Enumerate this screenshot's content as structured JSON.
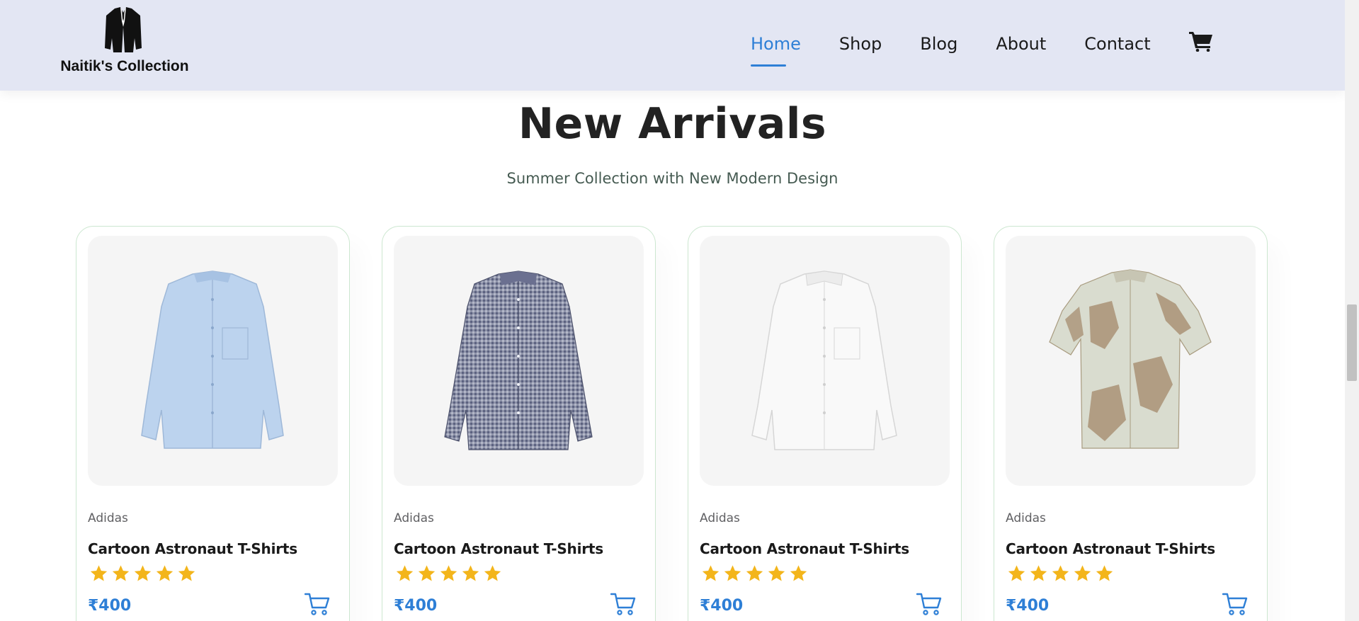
{
  "header": {
    "logo_text": "Naitik's Collection",
    "nav": [
      {
        "label": "Home",
        "active": true
      },
      {
        "label": "Shop",
        "active": false
      },
      {
        "label": "Blog",
        "active": false
      },
      {
        "label": "About",
        "active": false
      },
      {
        "label": "Contact",
        "active": false
      }
    ],
    "cart_icon": "shopping-cart-icon"
  },
  "section": {
    "title": "New Arrivals",
    "subtitle": "Summer Collection with New Modern Design"
  },
  "products": [
    {
      "brand": "Adidas",
      "name": "Cartoon Astronaut T-Shirts",
      "rating": 5,
      "price": "₹400",
      "image": "light-blue-mandarin-collar-shirt"
    },
    {
      "brand": "Adidas",
      "name": "Cartoon Astronaut T-Shirts",
      "rating": 5,
      "price": "₹400",
      "image": "navy-gingham-check-shirt"
    },
    {
      "brand": "Adidas",
      "name": "Cartoon Astronaut T-Shirts",
      "rating": 5,
      "price": "₹400",
      "image": "white-linen-shirt"
    },
    {
      "brand": "Adidas",
      "name": "Cartoon Astronaut T-Shirts",
      "rating": 5,
      "price": "₹400",
      "image": "beige-printed-short-sleeve-shirt"
    }
  ],
  "colors": {
    "accent": "#2e7fd6",
    "header_bg": "#e3e6f3",
    "star": "#f3b51b",
    "card_border": "#cce7d0"
  }
}
